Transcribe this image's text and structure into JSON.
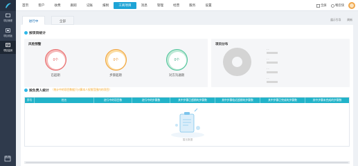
{
  "sidebar": {
    "items": [
      {
        "label": "项目管理",
        "icon": "folder-icon"
      },
      {
        "label": "项目看板",
        "icon": "dashboard-icon"
      },
      {
        "label": "项目监测",
        "icon": "monitor-icon"
      }
    ],
    "active_index": 2
  },
  "topnav": {
    "items": [
      "首页",
      "客户",
      "收费",
      "跟踪",
      "记账",
      "报税",
      "工商项目",
      "消息",
      "管理",
      "经营",
      "服务",
      "设置"
    ],
    "active_index": 6
  },
  "topright": {
    "fullscreen_label": "全屏",
    "switch_label": "畅云快"
  },
  "tabs": [
    "进行中",
    "全部"
  ],
  "active_tab": 0,
  "tab_ops": [
    "展示引导",
    "刷新"
  ],
  "stats": {
    "title": "按项目统计",
    "risk": {
      "title": "风险预警",
      "gauges": [
        {
          "value": "0个",
          "label": "已超期",
          "color": "#e25555"
        },
        {
          "value": "0个",
          "label": "步骤超期",
          "color": "#e8912a"
        },
        {
          "value": "0个",
          "label": "对方沟通期",
          "color": "#3aa882"
        }
      ]
    },
    "distribution": {
      "title": "项目分布",
      "legend": [
        {
          "label": "- -"
        },
        {
          "label": "- -"
        },
        {
          "label": "- -"
        },
        {
          "label": "- -"
        }
      ]
    }
  },
  "staff": {
    "title": "按负责人统计",
    "subtitle": "（统计中的项目数据只计算本人权限范围内的项目）",
    "columns": [
      "序号",
      "姓名",
      "进行中的项目数",
      "进行中的步骤数",
      "其中步骤已超期的步骤数",
      "其中步骤临近超期的步骤数",
      "其中步骤已完成的步骤数",
      "其中步骤未完成的步骤数"
    ],
    "empty_text": "暂无数据"
  },
  "colors": {
    "accent": "#1ea4d6",
    "table_header": "#22b3c9",
    "sidebar_bg": "#2f3a4c"
  }
}
